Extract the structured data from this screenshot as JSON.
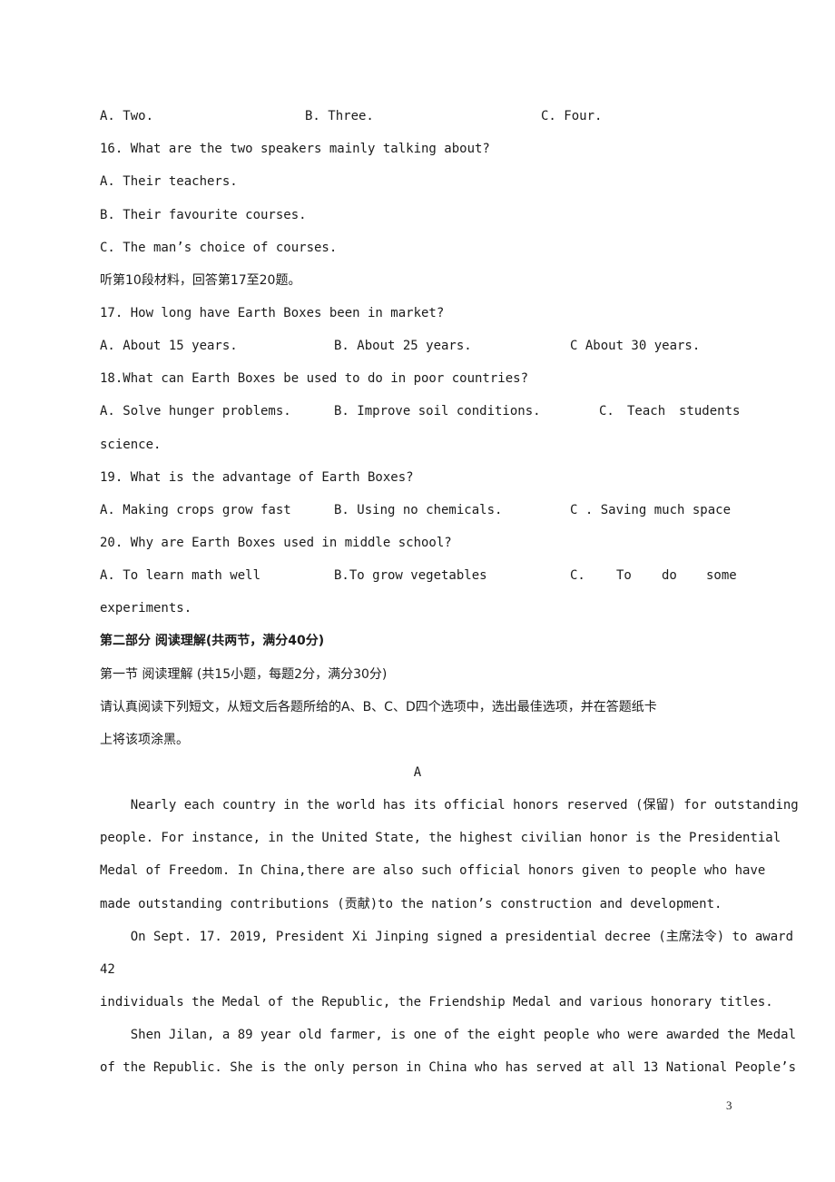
{
  "q15_options": {
    "a": "A. Two.",
    "b": "B. Three.",
    "c": "C. Four."
  },
  "q16": {
    "question": "16. What are the two speakers mainly talking about?",
    "a": "A. Their teachers.",
    "b": "B. Their favourite courses.",
    "c": "C. The man’s choice of courses."
  },
  "section10_instruction": "听第10段材料，回答第17至20题。",
  "q17": {
    "question": "17. How long have Earth Boxes been in market?",
    "a": "A. About 15 years.",
    "b": "B. About 25 years.",
    "c": "C About 30 years."
  },
  "q18": {
    "question": "18.What can Earth Boxes be used to do in poor countries?",
    "a": "A. Solve hunger problems.",
    "b": "B. Improve soil conditions.",
    "c_part1": "C.",
    "c_part2": "Teach",
    "c_part3": "students",
    "c_cont": "science."
  },
  "q19": {
    "question": "19. What is the advantage of Earth Boxes?",
    "a": "A. Making crops grow fast",
    "b": "B. Using no chemicals.",
    "c": "C . Saving much space"
  },
  "q20": {
    "question": "20. Why are Earth Boxes used in middle school?",
    "a": "A. To learn math well",
    "b": "B.To grow vegetables",
    "c_words": [
      "C.",
      "To",
      "do",
      "some"
    ],
    "c_cont": "experiments."
  },
  "part2": {
    "heading": "第二部分 阅读理解(共两节，满分40分)",
    "section1": "第一节 阅读理解 (共15小题，每题2分，满分30分)",
    "instruction_line1": "请认真阅读下列短文，从短文后各题所给的A、B、C、D四个选项中，选出最佳选项，并在答题纸卡",
    "instruction_line2": "上将该项涂黑。",
    "passage_label": "A"
  },
  "passage": {
    "lines": [
      "    Nearly each country in the world has its official honors reserved (保留) for outstanding",
      "people. For instance, in the United State, the highest civilian honor is the Presidential",
      "Medal of Freedom. In China,there are also such official honors given to people who have",
      "made outstanding contributions (贡献)to the nation’s construction and development.",
      "    On Sept. 17. 2019, President Xi Jinping signed a presidential decree (主席法令) to award",
      "42",
      "individuals the Medal of the Republic, the Friendship Medal and various honorary titles.",
      "    Shen Jilan, a 89 year old farmer, is one of the eight people who were awarded the Medal",
      "of the Republic. She is the only person in China who has served at all 13 National People’s"
    ]
  },
  "page_number": "3"
}
